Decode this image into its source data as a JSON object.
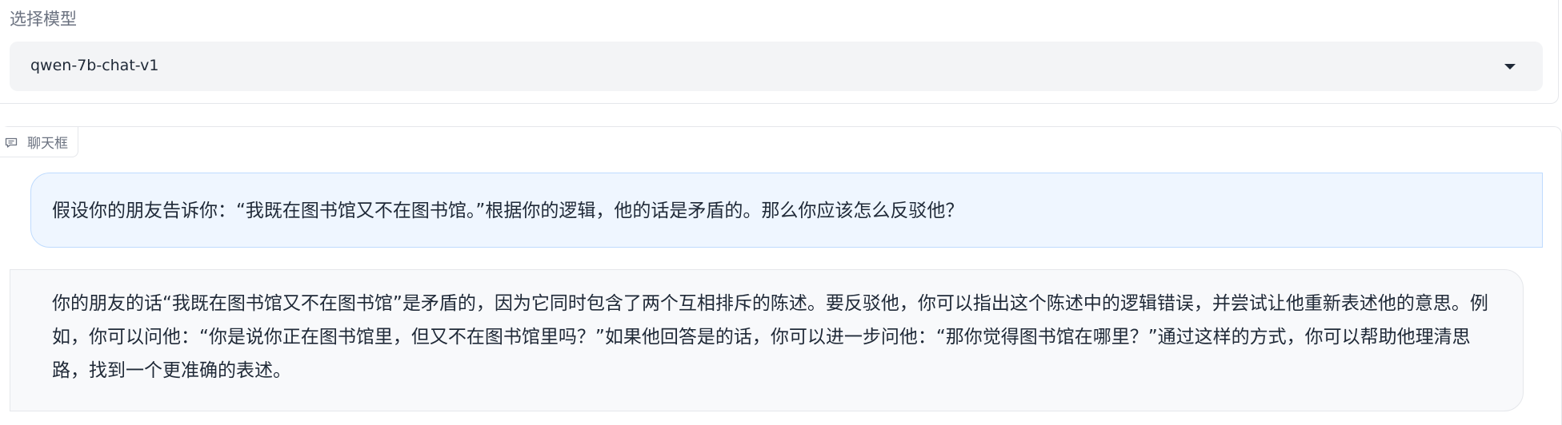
{
  "model_selector": {
    "label": "选择模型",
    "selected": "qwen-7b-chat-v1"
  },
  "chat": {
    "tab_label": "聊天框",
    "messages": [
      {
        "role": "user",
        "text": "假设你的朋友告诉你：“我既在图书馆又不在图书馆。”根据你的逻辑，他的话是矛盾的。那么你应该怎么反驳他？"
      },
      {
        "role": "assistant",
        "text": "你的朋友的话“我既在图书馆又不在图书馆”是矛盾的，因为它同时包含了两个互相排斥的陈述。要反驳他，你可以指出这个陈述中的逻辑错误，并尝试让他重新表述他的意思。例如，你可以问他：“你是说你正在图书馆里，但又不在图书馆里吗？”如果他回答是的话，你可以进一步问他：“那你觉得图书馆在哪里？”通过这样的方式，你可以帮助他理清思路，找到一个更准确的表述。"
      }
    ]
  },
  "icons": {
    "chat_tab": "chat-bubble-icon",
    "dropdown": "chevron-down-icon"
  },
  "colors": {
    "user_bubble_bg": "#eff6ff",
    "user_bubble_border": "#bfdbfe",
    "bot_bubble_bg": "#f8f9fb",
    "select_bg": "#f3f4f6"
  }
}
